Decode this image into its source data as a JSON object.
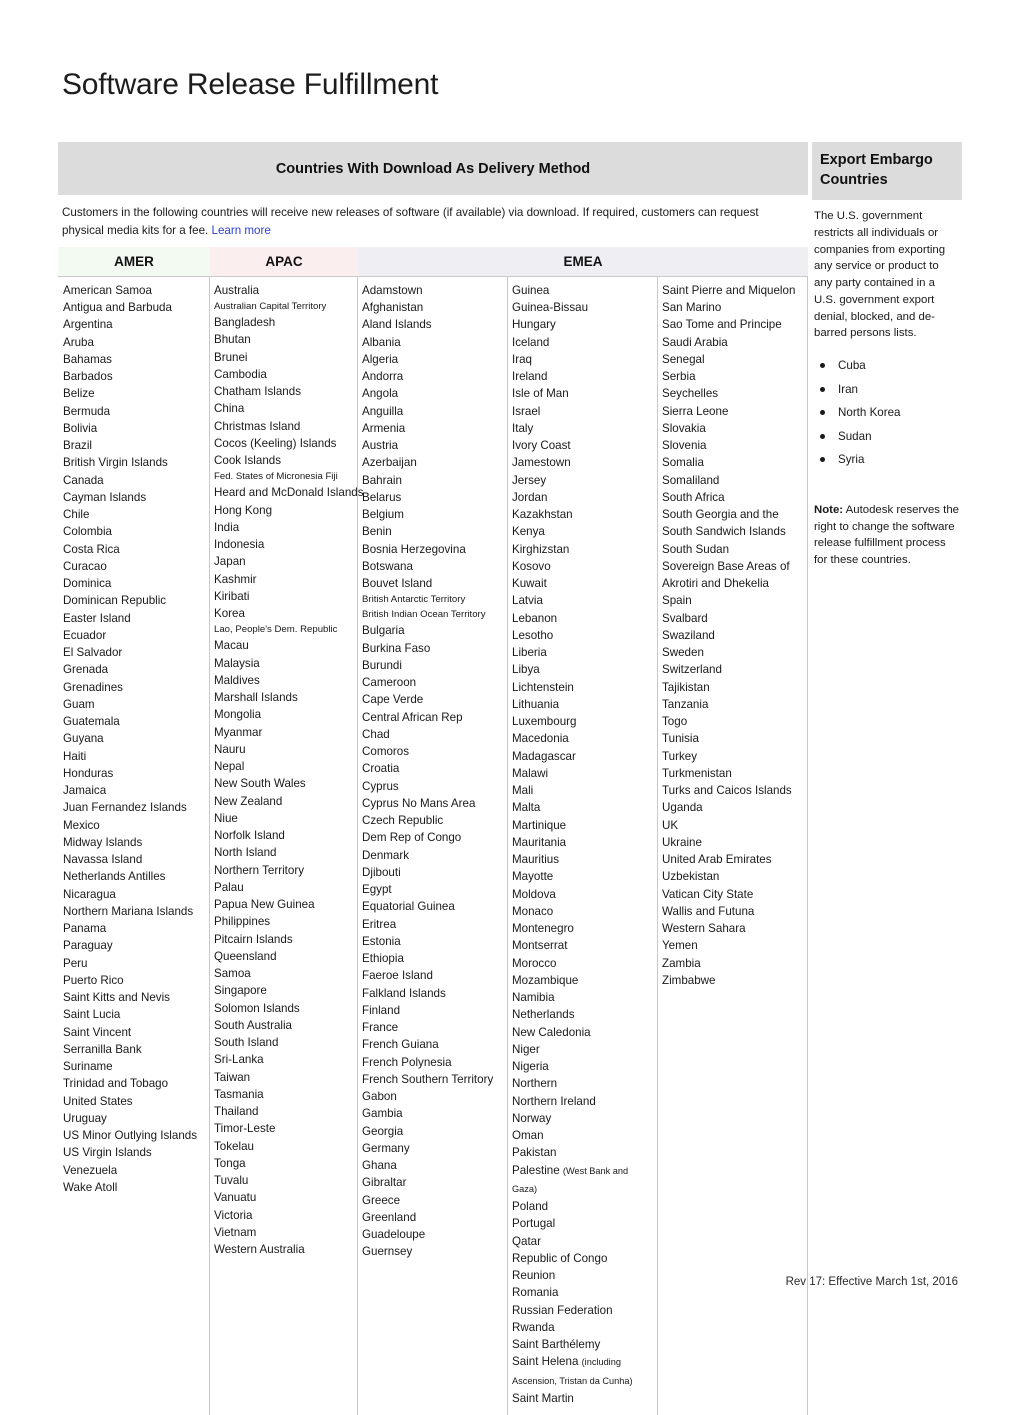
{
  "document": {
    "title": "Software Release Fulfillment",
    "footer_revision": "Rev 17: Effective March 1st, 2016"
  },
  "main_panel": {
    "header": "Countries With Download As Delivery Method",
    "intro_text": "Customers in the following countries will receive new releases of software (if available) via download. If required, customers can request physical media kits for a fee.",
    "learn_more_label": "Learn more"
  },
  "regions": {
    "amer_label": "AMER",
    "apac_label": "APAC",
    "emea_label": "EMEA",
    "amer_color": "#f2faf2",
    "apac_color": "#fbeeee",
    "emea_color": "#efeef3"
  },
  "columns": {
    "amer": [
      "American Samoa",
      "Antigua and Barbuda",
      "Argentina",
      "Aruba",
      "Bahamas",
      "Barbados",
      "Belize",
      "Bermuda",
      "Bolivia",
      "Brazil",
      "British Virgin Islands",
      "Canada",
      "Cayman Islands",
      "Chile",
      "Colombia",
      "Costa Rica",
      "Curacao",
      "Dominica",
      "Dominican Republic",
      "Easter Island",
      "Ecuador",
      "El Salvador",
      "Grenada",
      "Grenadines",
      "Guam",
      "Guatemala",
      "Guyana",
      "Haiti",
      "Honduras",
      "Jamaica",
      "Juan Fernandez Islands",
      "Mexico",
      "Midway Islands",
      "Navassa Island",
      "Netherlands Antilles",
      "Nicaragua",
      "Northern Mariana Islands",
      "Panama",
      "Paraguay",
      "Peru",
      "Puerto Rico",
      "Saint Kitts and Nevis",
      "Saint Lucia",
      "Saint Vincent",
      "Serranilla Bank",
      "Suriname",
      "Trinidad and Tobago",
      "United States",
      "Uruguay",
      "US Minor Outlying Islands",
      "US Virgin Islands",
      "Venezuela",
      "Wake Atoll"
    ],
    "apac": [
      "Australia",
      "Australian Capital Territory",
      "Bangladesh",
      "Bhutan",
      "Brunei",
      "Cambodia",
      "Chatham Islands",
      "China",
      "Christmas Island",
      "Cocos (Keeling) Islands",
      "Cook Islands",
      "Fed. States of Micronesia Fiji",
      "Heard and McDonald Islands",
      "Hong Kong",
      "India",
      "Indonesia",
      "Japan",
      "Kashmir",
      "Kiribati",
      "Korea",
      "Lao, People's Dem. Republic",
      "Macau",
      "Malaysia",
      "Maldives",
      "Marshall Islands",
      "Mongolia",
      "Myanmar",
      "Nauru",
      "Nepal",
      "New South Wales",
      "New Zealand",
      "Niue",
      "Norfolk Island",
      "North Island",
      "Northern Territory",
      "Palau",
      "Papua New Guinea",
      "Philippines",
      "Pitcairn Islands",
      "Queensland",
      "Samoa",
      "Singapore",
      "Solomon Islands",
      "South Australia",
      "South Island",
      "Sri-Lanka",
      "Taiwan",
      "Tasmania",
      "Thailand",
      "Timor-Leste",
      "Tokelau",
      "Tonga",
      "Tuvalu",
      "Vanuatu",
      "Victoria",
      "Vietnam",
      "Western Australia"
    ],
    "emea_1": [
      "Adamstown",
      "Afghanistan",
      "Aland Islands",
      "Albania",
      "Algeria",
      "Andorra",
      "Angola",
      "Anguilla",
      "Armenia",
      "Austria",
      "Azerbaijan",
      "Bahrain",
      "Belarus",
      "Belgium",
      "Benin",
      "Bosnia Herzegovina",
      "Botswana",
      "Bouvet Island",
      "British Antarctic Territory",
      "British Indian Ocean Territory",
      "Bulgaria",
      "Burkina Faso",
      "Burundi",
      "Cameroon",
      "Cape Verde",
      "Central African Rep",
      "Chad",
      "Comoros",
      "Croatia",
      "Cyprus",
      "Cyprus No Mans Area",
      "Czech Republic",
      "Dem Rep of Congo",
      "Denmark",
      "Djibouti",
      "Egypt",
      "Equatorial Guinea",
      "Eritrea",
      "Estonia",
      "Ethiopia",
      "Faeroe Island",
      "Falkland Islands",
      "Finland",
      "France",
      "French Guiana",
      "French Polynesia",
      "French Southern Territory",
      "Gabon",
      "Gambia",
      "Georgia",
      "Germany",
      "Ghana",
      "Gibraltar",
      "Greece",
      "Greenland",
      "Guadeloupe",
      "Guernsey"
    ],
    "emea_2": [
      "Guinea",
      "Guinea-Bissau",
      "Hungary",
      "Iceland",
      "Iraq",
      "Ireland",
      "Isle of Man",
      "Israel",
      "Italy",
      "Ivory Coast",
      "Jamestown",
      "Jersey",
      "Jordan",
      "Kazakhstan",
      "Kenya",
      "Kirghizstan",
      "Kosovo",
      "Kuwait",
      "Latvia",
      "Lebanon",
      "Lesotho",
      "Liberia",
      "Libya",
      "Lichtenstein",
      "Lithuania",
      "Luxembourg",
      "Macedonia",
      "Madagascar",
      "Malawi",
      "Mali",
      "Malta",
      "Martinique",
      "Mauritania",
      "Mauritius",
      "Mayotte",
      "Moldova",
      "Monaco",
      "Montenegro",
      "Montserrat",
      "Morocco",
      "Mozambique",
      "Namibia",
      "Netherlands",
      "New Caledonia",
      "Niger",
      "Nigeria",
      "Northern",
      "Northern Ireland",
      "Norway",
      "Oman",
      "Pakistan",
      "Palestine (West Bank and Gaza)",
      "Poland",
      "Portugal",
      "Qatar",
      "Republic of Congo",
      "Reunion",
      "Romania",
      "Russian Federation",
      "Rwanda",
      "Saint Barthélemy",
      "Saint Helena (including Ascension, Tristan da Cunha)",
      "Saint Martin"
    ],
    "emea_3": [
      "Saint Pierre and Miquelon",
      "San Marino",
      "Sao Tome and Principe",
      "Saudi Arabia",
      "Senegal",
      "Serbia",
      "Seychelles",
      "Sierra Leone",
      "Slovakia",
      "Slovenia",
      "Somalia",
      "Somaliland",
      "South Africa",
      "South Georgia and the South Sandwich Islands",
      "South Sudan",
      "Sovereign Base Areas of Akrotiri and Dhekelia",
      "Spain",
      "Svalbard",
      "Swaziland",
      "Sweden",
      "Switzerland",
      "Tajikistan",
      "Tanzania",
      "Togo",
      "Tunisia",
      "Turkey",
      "Turkmenistan",
      "Turks and Caicos Islands",
      "Uganda",
      "UK",
      "Ukraine",
      "United Arab Emirates",
      "Uzbekistan",
      "Vatican City State",
      "Wallis and Futuna",
      "Western Sahara",
      "Yemen",
      "Zambia",
      "Zimbabwe"
    ]
  },
  "sidebar": {
    "header": "Export Embargo Countries",
    "body_text": "The U.S. government restricts all individuals or companies from exporting any service or product to any party contained in a U.S. government export denial, blocked, and de-barred persons lists.",
    "embargo_countries": [
      "Cuba",
      "Iran",
      "North Korea",
      "Sudan",
      "Syria"
    ],
    "note_label": "Note:",
    "note_text": "Autodesk reserves the right to change the software release fulfillment process for these countries."
  }
}
